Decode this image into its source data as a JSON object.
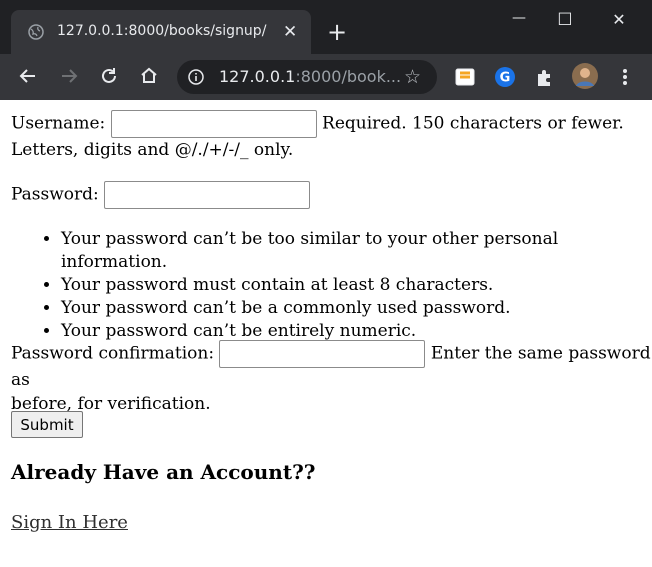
{
  "browser": {
    "tab_title": "127.0.0.1:8000/books/signup/",
    "tab_close": "✕",
    "new_tab": "+",
    "url_host": "127.0.0.1",
    "url_rest": ":8000/book...",
    "minimize": "—",
    "maximize": "☐",
    "close": "✕",
    "colors": {
      "titlebar": "#202124",
      "toolbar": "#35363a",
      "omnibox": "#202124"
    }
  },
  "form": {
    "username_label": "Username:",
    "username_value": "",
    "username_help_1": "Required. 150 characters or fewer.",
    "username_help_2": "Letters, digits and @/./+/-/_ only.",
    "password_label": "Password:",
    "password_value": "",
    "password_rules": [
      "Your password can’t be too similar to your other personal information.",
      "Your password must contain at least 8 characters.",
      "Your password can’t be a commonly used password.",
      "Your password can’t be entirely numeric."
    ],
    "confirm_label": "Password confirmation:",
    "confirm_value": "",
    "confirm_help_1": "Enter the same password as",
    "confirm_help_2": "before, for verification.",
    "submit_label": "Submit"
  },
  "account": {
    "heading": "Already Have an Account??",
    "signin_link": "Sign In Here"
  }
}
